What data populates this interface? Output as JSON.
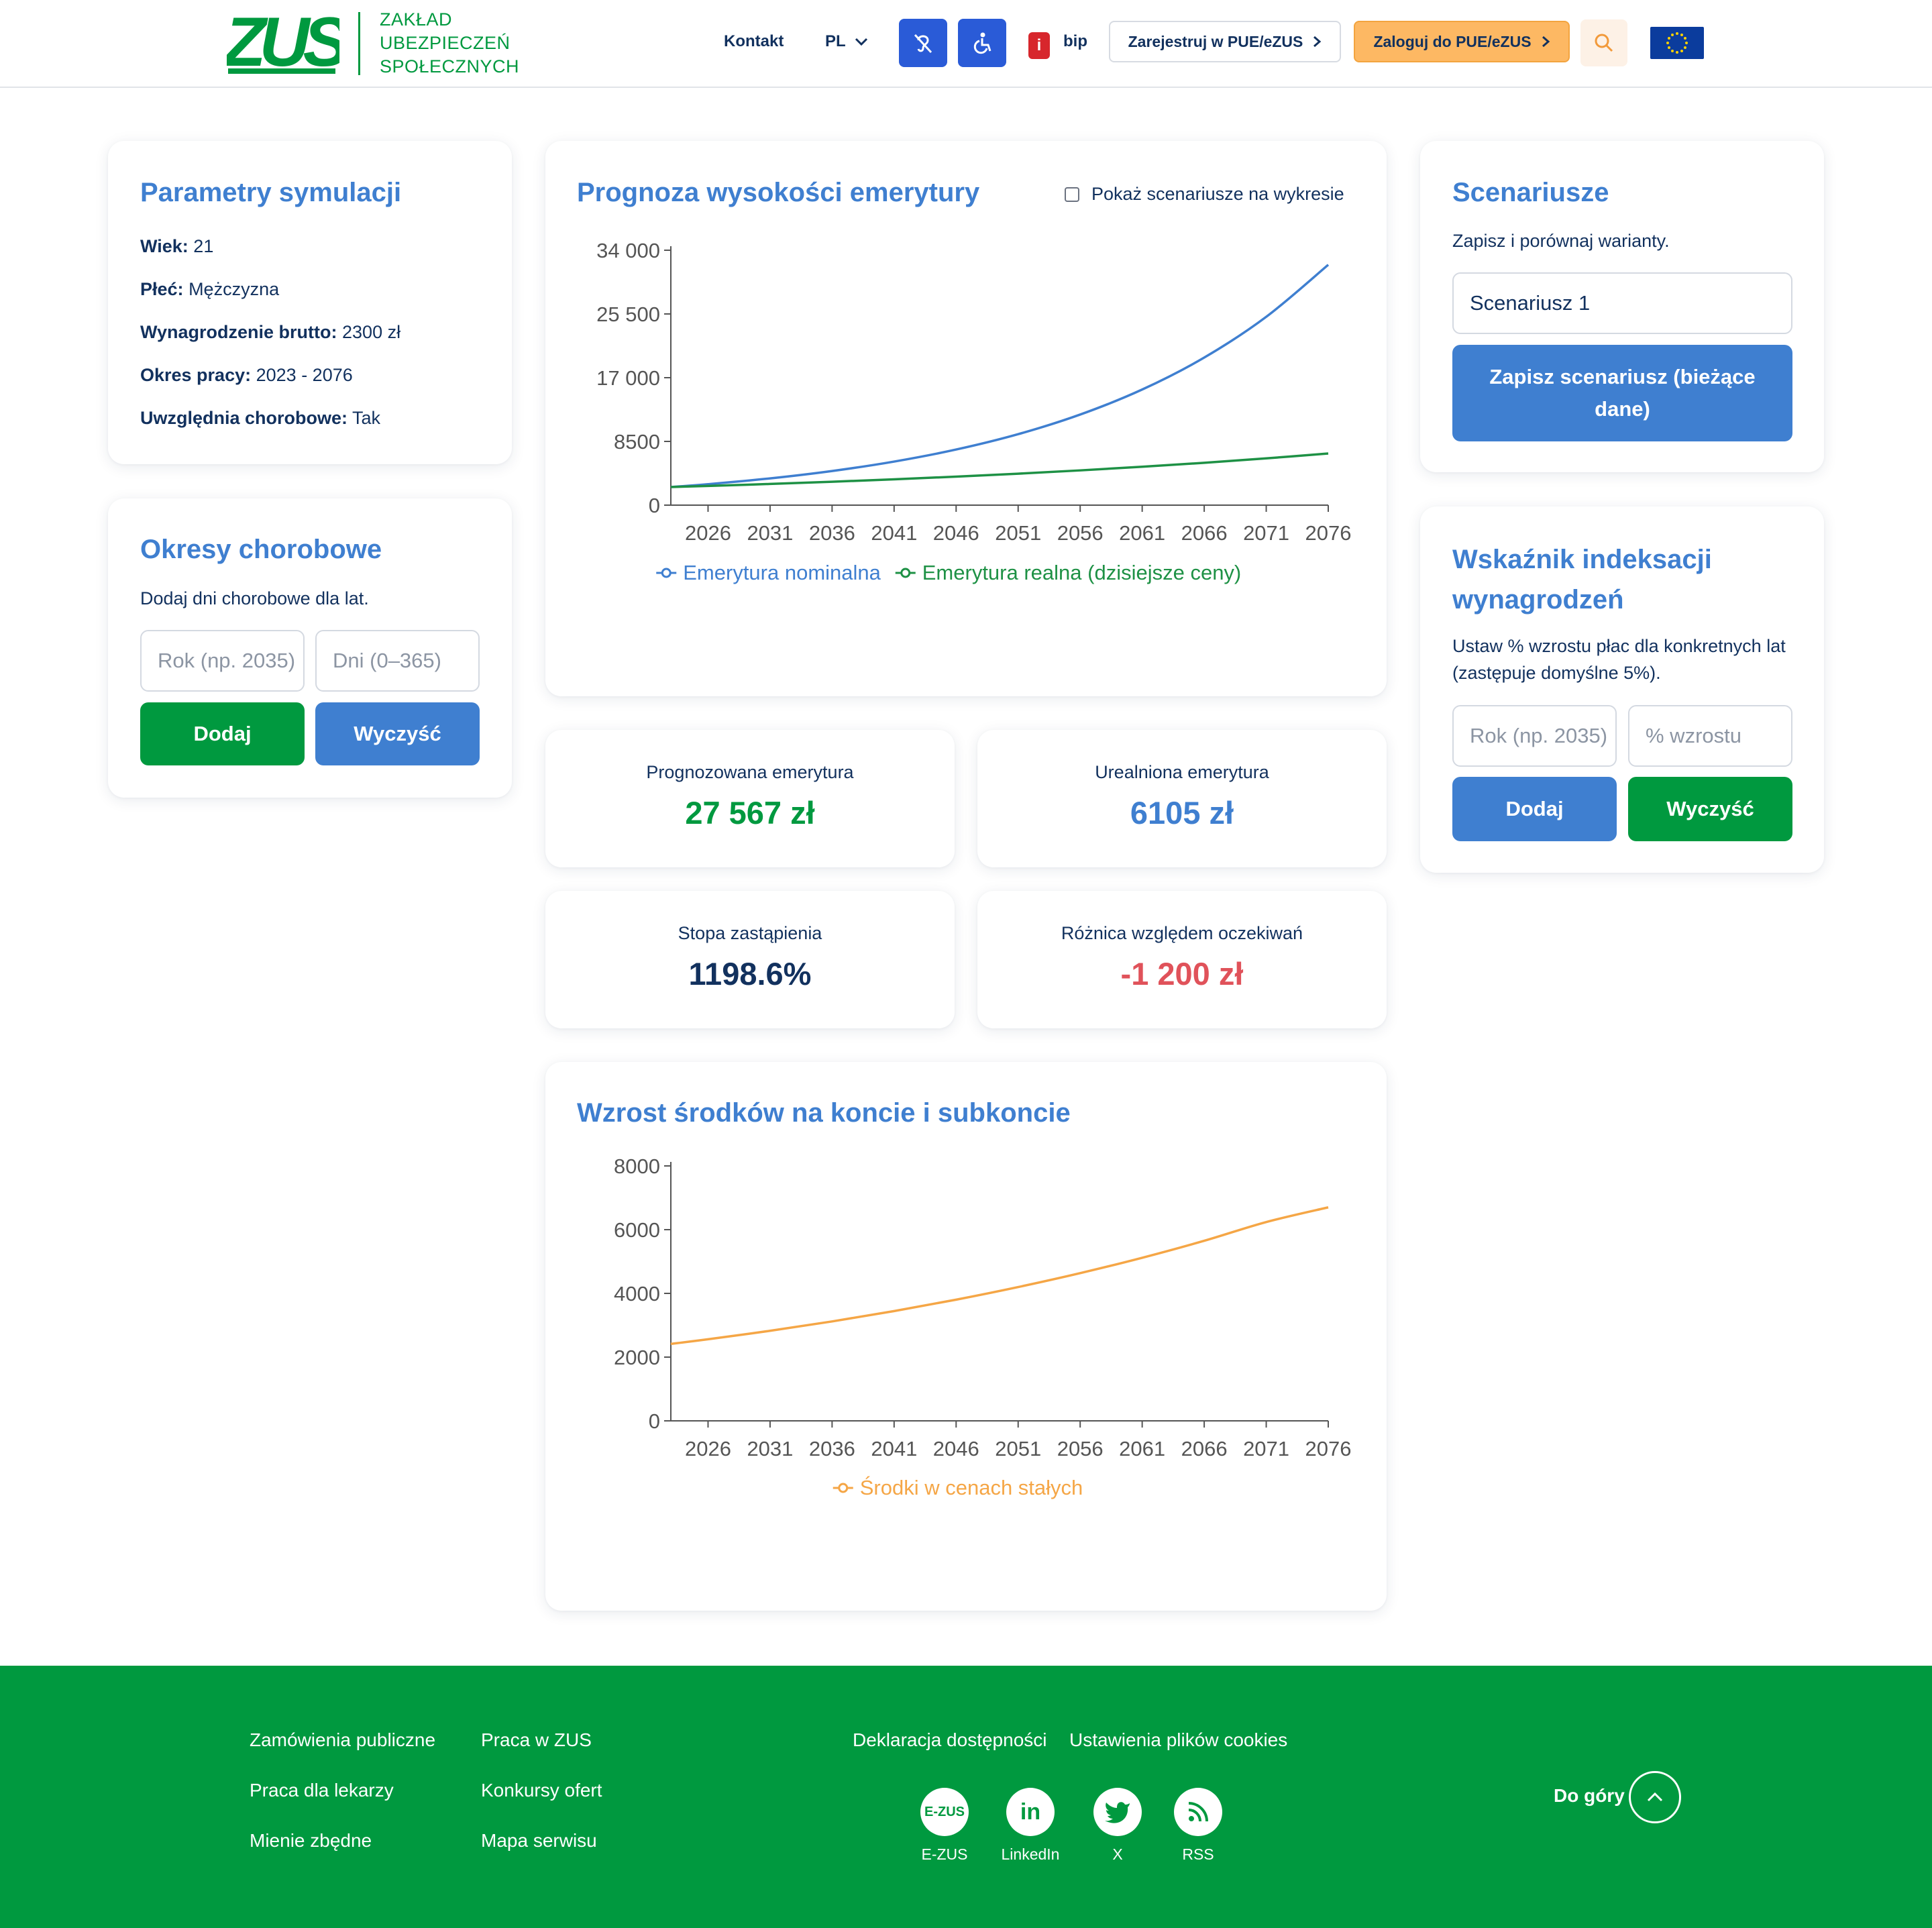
{
  "header": {
    "logo_mark": "ZUS",
    "logo_lines": [
      "ZAKŁAD",
      "UBEZPIECZEŃ",
      "SPOŁECZNYCH"
    ],
    "nav": {
      "contact": "Kontakt",
      "language": "PL"
    },
    "bip": {
      "badge": "i",
      "label": "bip"
    },
    "register_label": "Zarejestruj w PUE/eZUS",
    "login_label": "Zaloguj do PUE/eZUS",
    "icons": [
      "deaf-icon",
      "wheelchair-icon",
      "search-icon",
      "eu-flag-icon",
      "chevron-right-icon",
      "chevron-down-icon"
    ]
  },
  "params": {
    "title": "Parametry symulacji",
    "items": [
      {
        "label": "Wiek:",
        "value": "21"
      },
      {
        "label": "Płeć:",
        "value": "Mężczyzna"
      },
      {
        "label": "Wynagrodzenie brutto:",
        "value": "2300 zł"
      },
      {
        "label": "Okres pracy:",
        "value": "2023 - 2076"
      },
      {
        "label": "Uwzględnia chorobowe:",
        "value": "Tak"
      }
    ]
  },
  "sick": {
    "title": "Okresy chorobowe",
    "desc": "Dodaj dni chorobowe dla lat.",
    "year_placeholder": "Rok (np. 2035)",
    "days_placeholder": "Dni (0–365)",
    "add_label": "Dodaj",
    "clear_label": "Wyczyść"
  },
  "scenarios": {
    "title": "Scenariusze",
    "desc": "Zapisz i porównaj warianty.",
    "name_value": "Scenariusz 1",
    "save_label": "Zapisz scenariusz (bieżące dane)"
  },
  "indexation": {
    "title": "Wskaźnik indeksacji wynagrodzeń",
    "desc": "Ustaw % wzrostu płac dla konkretnych lat (zastępuje domyślne 5%).",
    "year_placeholder": "Rok (np. 2035)",
    "pct_placeholder": "% wzrostu",
    "add_label": "Dodaj",
    "clear_label": "Wyczyść"
  },
  "stats": [
    {
      "label": "Prognozowana emerytura",
      "value": "27 567 zł",
      "color": "#00993f"
    },
    {
      "label": "Urealniona emerytura",
      "value": "6105 zł",
      "color": "#3f7fd0"
    },
    {
      "label": "Stopa zastąpienia",
      "value": "1198.6%",
      "color": "#12315e"
    },
    {
      "label": "Różnica względem oczekiwań",
      "value": "-1 200 zł",
      "color": "#e0525a"
    }
  ],
  "chart_data": [
    {
      "type": "line",
      "title": "Prognoza wysokości emerytury",
      "checkbox_label": "Pokaż scenariusze na wykresie",
      "checkbox_checked": false,
      "x": [
        2023,
        2026,
        2031,
        2036,
        2041,
        2046,
        2051,
        2056,
        2061,
        2066,
        2071,
        2076
      ],
      "xticks": [
        "2026",
        "2031",
        "2036",
        "2041",
        "2046",
        "2051",
        "2056",
        "2061",
        "2066",
        "2071",
        "2076"
      ],
      "yticks": [
        "0",
        "8500",
        "17 000",
        "25 500",
        "34 000"
      ],
      "ylim": [
        0,
        34000
      ],
      "series": [
        {
          "name": "Emerytura nominalna",
          "color": "#3f7fd0",
          "values": [
            2415,
            2796,
            3568,
            4554,
            5812,
            7418,
            9467,
            12083,
            15421,
            19682,
            25120,
            32060
          ]
        },
        {
          "name": "Emerytura realna (dzisiejsze ceny)",
          "color": "#1e9145",
          "values": [
            2415,
            2560,
            2826,
            3120,
            3444,
            3803,
            4199,
            4636,
            5118,
            5651,
            6239,
            6889
          ]
        }
      ],
      "legend": "bottom"
    },
    {
      "type": "line",
      "title": "Wzrost środków na koncie i subkoncie",
      "x": [
        2023,
        2026,
        2031,
        2036,
        2041,
        2046,
        2051,
        2056,
        2061,
        2066,
        2071,
        2076
      ],
      "xticks": [
        "2026",
        "2031",
        "2036",
        "2041",
        "2046",
        "2051",
        "2056",
        "2061",
        "2066",
        "2071",
        "2076"
      ],
      "yticks": [
        "0",
        "2000",
        "4000",
        "6000",
        "8000"
      ],
      "ylim": [
        0,
        8000
      ],
      "series": [
        {
          "name": "Środki w cenach stałych",
          "color": "#f5a646",
          "values": [
            2415,
            2560,
            2826,
            3120,
            3444,
            3803,
            4199,
            4636,
            5118,
            5651,
            6239,
            6700
          ]
        }
      ],
      "legend": "bottom"
    }
  ],
  "footer": {
    "col1": [
      "Zamówienia publiczne",
      "Praca dla lekarzy",
      "Mienie zbędne"
    ],
    "col2": [
      "Praca w ZUS",
      "Konkursy ofert",
      "Mapa serwisu"
    ],
    "top_links": [
      "Deklaracja dostępności",
      "Ustawienia plików cookies"
    ],
    "social": [
      {
        "label": "E-ZUS",
        "icon_text": "E-ZUS"
      },
      {
        "label": "LinkedIn",
        "icon_text": "in"
      },
      {
        "label": "X",
        "icon_text": ""
      },
      {
        "label": "RSS",
        "icon_text": ""
      }
    ],
    "to_top": "Do góry"
  }
}
